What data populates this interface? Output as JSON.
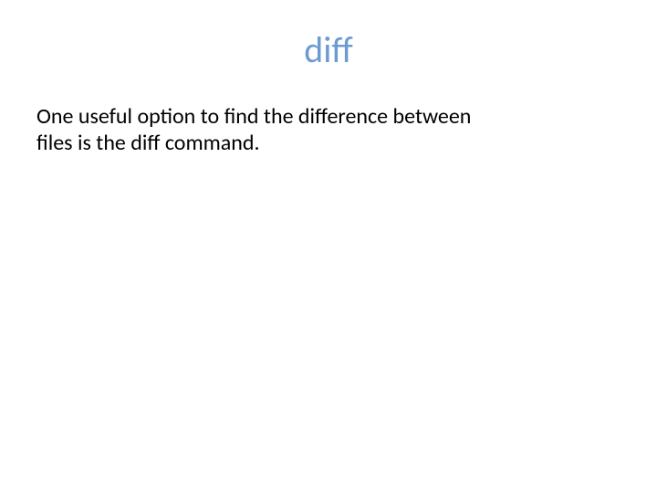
{
  "slide": {
    "title": "diff",
    "body": "One useful option to find the difference between files is the diff command."
  }
}
